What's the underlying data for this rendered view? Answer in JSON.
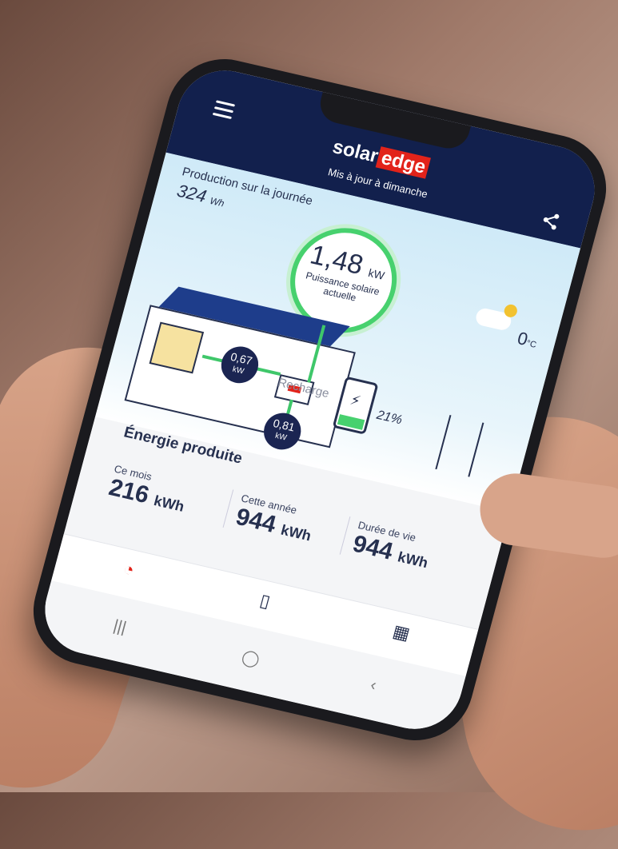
{
  "app": {
    "logo_part1": "solar",
    "logo_part2": "edge",
    "updated_text": "Mis à jour à dimanche"
  },
  "production": {
    "label": "Production sur la journée",
    "value": "324",
    "unit": "Wh"
  },
  "solar_power": {
    "value": "1,48",
    "unit": "kW",
    "label_line1": "Puissance solaire",
    "label_line2": "actuelle"
  },
  "weather": {
    "temperature": "0",
    "unit": "°C"
  },
  "flows": {
    "home_value": "0,67",
    "home_unit": "kW",
    "battery_value": "0,81",
    "battery_unit": "kW"
  },
  "battery": {
    "label": "Recharge",
    "percent": "21%",
    "level": 0.21
  },
  "energy": {
    "title": "Énergie produite",
    "stats": [
      {
        "label": "Ce mois",
        "value": "216",
        "unit": "kWh"
      },
      {
        "label": "Cette année",
        "value": "944",
        "unit": "kWh"
      },
      {
        "label": "Durée de vie",
        "value": "944",
        "unit": "kWh"
      }
    ]
  },
  "tabs": [
    {
      "icon": "gauge-icon"
    },
    {
      "icon": "battery-icon"
    },
    {
      "icon": "solar-panel-icon"
    }
  ],
  "system_nav": [
    {
      "icon": "recent-apps-icon",
      "glyph": "|||"
    },
    {
      "icon": "home-icon",
      "glyph": "◯"
    },
    {
      "icon": "back-icon",
      "glyph": "‹"
    }
  ],
  "colors": {
    "brand_navy": "#12204d",
    "brand_red": "#e2231a",
    "flow_green": "#47d16e"
  }
}
